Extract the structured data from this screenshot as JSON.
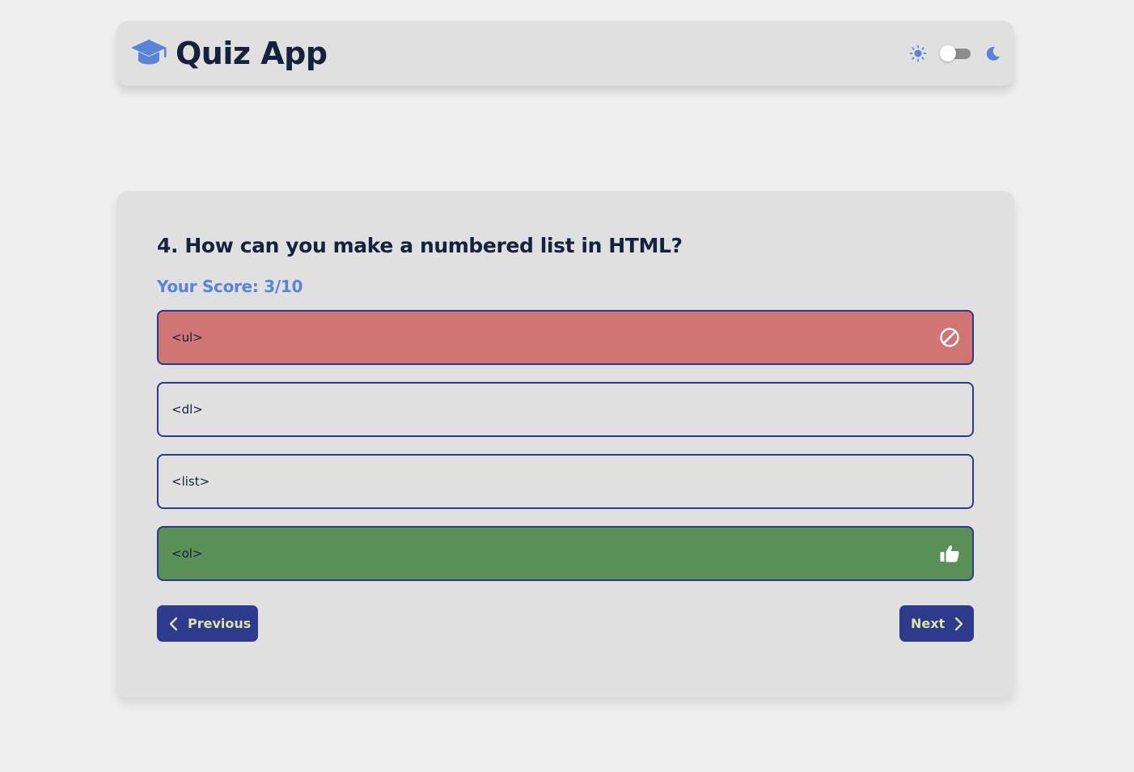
{
  "app": {
    "title": "Quiz App",
    "logo_icon": "graduation-cap-icon",
    "accent_color": "#5b84d6"
  },
  "theme": {
    "light_icon": "sun-icon",
    "dark_icon": "moon-icon",
    "dark_mode_enabled": false
  },
  "quiz": {
    "question": "4. How can you make a numbered list in HTML?",
    "score_text": "Your Score: 3/10",
    "options": [
      {
        "label": "<ul>",
        "state": "wrong",
        "icon": "ban-icon",
        "color": "#d07573"
      },
      {
        "label": "<dl>",
        "state": "neutral",
        "icon": "",
        "color": "#e1e0e1"
      },
      {
        "label": "<list>",
        "state": "neutral",
        "icon": "",
        "color": "#e1e0e1"
      },
      {
        "label": "<ol>",
        "state": "correct",
        "icon": "thumbs-up-icon",
        "color": "#5a8f56"
      }
    ]
  },
  "nav": {
    "previous_label": "Previous",
    "next_label": "Next",
    "button_color": "#2e3a8c"
  }
}
